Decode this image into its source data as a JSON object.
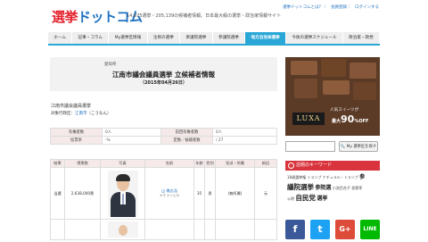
{
  "header": {
    "logo_part1": "選挙",
    "logo_part2": "ドットコム",
    "tagline": "14,875選挙・205,139の候補者情報。日本最大級の選挙・政治家情報サイト",
    "links": [
      "選挙ドットコムとは？",
      "会員登録",
      "ログインする"
    ]
  },
  "nav": {
    "items": [
      "ホーム",
      "記事・コラム",
      "My選挙区情報",
      "注目の選挙",
      "衆議院選挙",
      "参議院選挙",
      "地方自治体選挙",
      "今後の選挙スケジュール",
      "政治家・政党"
    ],
    "active_index": 6
  },
  "election": {
    "prefecture": "愛知県",
    "title": "江南市議会議員選挙 立候補者情報",
    "date": "（2015年04月26日）",
    "subtitle": "江南市議会議員選挙",
    "area_label": "対象行政区：",
    "area_link": "江南市",
    "area_kana": "（こうなん）"
  },
  "summary": {
    "rows": [
      {
        "h1": "有権者数",
        "v1": "0人",
        "h2": "前回有権者数",
        "v2": "0人"
      },
      {
        "h1": "投票率",
        "v1": "-%",
        "h2": "定数／候補者数",
        "v2": "/ 27"
      }
    ]
  },
  "candidates": {
    "headers": [
      "結果",
      "得票数",
      "写真",
      "名前",
      "年齢",
      "性別",
      "党派・所属",
      "新旧"
    ],
    "rows": [
      {
        "result": "当選",
        "votes": "2,638,000票",
        "name": "山 敬志浩",
        "kana": "ヤマ ケシヒロ",
        "age": "35",
        "gender": "男",
        "party": "(無所属)",
        "status": "元"
      }
    ]
  },
  "sidebar": {
    "ad": {
      "brand": "LUXA",
      "copy": "人気スイーツが",
      "discount": "最大90%OFF",
      "discount_small": "最大",
      "discount_big": "90",
      "discount_unit": "%OFF"
    },
    "search_button": "My 選挙区を探す",
    "keywords_title": "話題のキーワード",
    "keywords": [
      {
        "text": "18歳選挙権",
        "size": "sm"
      },
      {
        "text": "トランプ",
        "size": "sm"
      },
      {
        "text": "ナチュラル・トランプ",
        "size": "sm"
      },
      {
        "text": "参",
        "size": "med"
      },
      {
        "text": "議院選挙",
        "size": "big"
      },
      {
        "text": "参院選",
        "size": "med"
      },
      {
        "text": "小池百合子",
        "size": "sm"
      },
      {
        "text": "投票率",
        "size": "sm"
      },
      {
        "text": "公明",
        "size": "sm"
      },
      {
        "text": "自民党",
        "size": "big"
      },
      {
        "text": "選挙",
        "size": "med"
      }
    ],
    "social": [
      {
        "name": "facebook",
        "glyph": "f",
        "color": "#3b5998"
      },
      {
        "name": "twitter",
        "glyph": "t",
        "color": "#1da1f2"
      },
      {
        "name": "google-plus",
        "glyph": "G+",
        "color": "#dd4b39"
      },
      {
        "name": "line",
        "glyph": "LINE",
        "color": "#00b900"
      }
    ]
  }
}
